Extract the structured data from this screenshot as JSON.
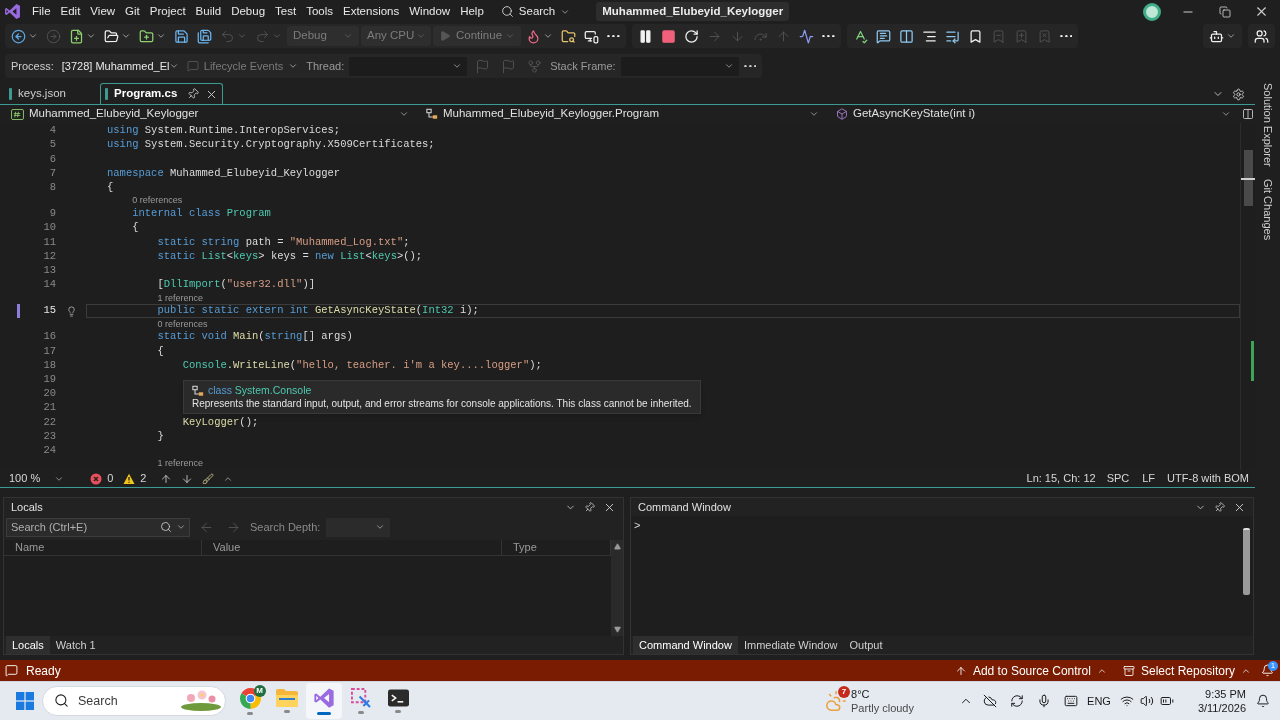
{
  "title_bar": {
    "menus": [
      "File",
      "Edit",
      "View",
      "Git",
      "Project",
      "Build",
      "Debug",
      "Test",
      "Tools",
      "Extensions",
      "Window",
      "Help"
    ],
    "search": "Search",
    "solution": "Muhammed_Elubeyid_Keylogger"
  },
  "toolbar": {
    "groups": [
      {
        "buttons": [
          {
            "kind": "navigate-back",
            "disabled": false
          },
          {
            "kind": "navigate-forward",
            "disabled": true
          },
          {
            "kind": "new-item",
            "disabled": false
          },
          {
            "kind": "open-file",
            "disabled": false
          },
          {
            "kind": "add-project",
            "disabled": false
          },
          {
            "kind": "save",
            "disabled": false
          },
          {
            "kind": "save-all",
            "disabled": false
          },
          {
            "kind": "undo",
            "disabled": true
          },
          {
            "kind": "redo",
            "disabled": true
          },
          {
            "kind": "configuration",
            "label": "Debug",
            "disabled": true
          },
          {
            "kind": "platform",
            "label": "Any CPU",
            "disabled": true
          },
          {
            "kind": "continue",
            "label": "Continue",
            "disabled": true
          },
          {
            "kind": "hot-reload",
            "disabled": false
          },
          {
            "kind": "find-in-files",
            "disabled": false
          },
          {
            "kind": "browser-link",
            "disabled": false
          },
          {
            "kind": "more",
            "disabled": false
          }
        ]
      },
      {
        "buttons": [
          {
            "kind": "pause",
            "disabled": false
          },
          {
            "kind": "stop",
            "disabled": false
          },
          {
            "kind": "restart",
            "disabled": false
          },
          {
            "kind": "show-next",
            "disabled": true
          },
          {
            "kind": "step-into",
            "disabled": true
          },
          {
            "kind": "step-over",
            "disabled": true
          },
          {
            "kind": "step-out",
            "disabled": true
          },
          {
            "kind": "diagnostics",
            "disabled": false
          },
          {
            "kind": "more",
            "disabled": false
          }
        ]
      },
      {
        "buttons": [
          {
            "kind": "spell-check",
            "disabled": false
          },
          {
            "kind": "quick-info",
            "disabled": false
          },
          {
            "kind": "parameter-info",
            "disabled": false
          },
          {
            "kind": "outdent",
            "disabled": false
          },
          {
            "kind": "indent",
            "disabled": false
          },
          {
            "kind": "bookmark",
            "disabled": false
          },
          {
            "kind": "previous-bookmark",
            "disabled": true
          },
          {
            "kind": "next-bookmark",
            "disabled": true
          },
          {
            "kind": "clear-bookmarks",
            "disabled": true
          },
          {
            "kind": "more",
            "disabled": false
          }
        ]
      },
      {
        "buttons": [
          {
            "kind": "assistant",
            "disabled": false
          }
        ]
      },
      {
        "buttons": [
          {
            "kind": "feedback",
            "disabled": false
          }
        ]
      }
    ]
  },
  "debug_location": {
    "process_label": "Process:",
    "process": "[3728] Muhammed_El",
    "lifecycle": {
      "label": "Lifecycle Events",
      "disabled": true
    },
    "thread_label": "Thread:",
    "buttons": [
      {
        "kind": "flag",
        "disabled": true
      },
      {
        "kind": "flag-all",
        "disabled": true
      },
      {
        "kind": "threads",
        "disabled": true
      }
    ],
    "stack_frame_label": "Stack Frame:"
  },
  "document_tabs": [
    {
      "label": "keys.json",
      "selected": false
    },
    {
      "label": "Program.cs",
      "selected": true
    }
  ],
  "navigation_bar": {
    "project": "Muhammed_Elubeyid_Keylogger",
    "type": "Muhammed_Elubeyid_Keylogger.Program",
    "member": "GetAsyncKeyState(int i)"
  },
  "editor": {
    "lines": [
      {
        "kind": "code",
        "number": "4",
        "current": false,
        "tokens": [
          {
            "kind": "keyword",
            "text": "using"
          },
          {
            "kind": "plain",
            "text": " System.Runtime.InteropServices;"
          }
        ]
      },
      {
        "kind": "code",
        "number": "5",
        "current": false,
        "tokens": [
          {
            "kind": "keyword",
            "text": "using"
          },
          {
            "kind": "plain",
            "text": " System.Security.Cryptography.X509Certificates;"
          }
        ]
      },
      {
        "kind": "code",
        "number": "6",
        "current": false
      },
      {
        "kind": "code",
        "number": "7",
        "current": false,
        "tokens": [
          {
            "kind": "keyword",
            "text": "namespace"
          },
          {
            "kind": "plain",
            "text": " Muhammed_Elubeyid_Keylogger"
          }
        ]
      },
      {
        "kind": "code",
        "number": "8",
        "current": false,
        "tokens": [
          {
            "kind": "plain",
            "text": "{"
          }
        ]
      },
      {
        "kind": "codelens",
        "text": "0 references"
      },
      {
        "kind": "code",
        "number": "9",
        "current": false,
        "tokens": [
          {
            "kind": "keyword",
            "text": "    internal class"
          },
          {
            "kind": "type",
            "text": " Program"
          }
        ]
      },
      {
        "kind": "code",
        "number": "10",
        "current": false,
        "tokens": [
          {
            "kind": "plain",
            "text": "    {"
          }
        ]
      },
      {
        "kind": "code",
        "number": "11",
        "current": false,
        "tokens": [
          {
            "kind": "keyword",
            "text": "        static string"
          },
          {
            "kind": "plain",
            "text": " path = "
          },
          {
            "kind": "string",
            "text": "\"Muhammed_Log.txt\""
          },
          {
            "kind": "plain",
            "text": ";"
          }
        ]
      },
      {
        "kind": "code",
        "number": "12",
        "current": false,
        "tokens": [
          {
            "kind": "keyword",
            "text": "        static"
          },
          {
            "kind": "type",
            "text": " List"
          },
          {
            "kind": "plain",
            "text": "<"
          },
          {
            "kind": "type",
            "text": "keys"
          },
          {
            "kind": "plain",
            "text": "> keys = "
          },
          {
            "kind": "keyword",
            "text": "new"
          },
          {
            "kind": "type",
            "text": " List"
          },
          {
            "kind": "plain",
            "text": "<"
          },
          {
            "kind": "type",
            "text": "keys"
          },
          {
            "kind": "plain",
            "text": ">();"
          }
        ]
      },
      {
        "kind": "code",
        "number": "13",
        "current": false
      },
      {
        "kind": "code",
        "number": "14",
        "current": false,
        "tokens": [
          {
            "kind": "plain",
            "text": "        ["
          },
          {
            "kind": "type",
            "text": "DllImport"
          },
          {
            "kind": "plain",
            "text": "("
          },
          {
            "kind": "string",
            "text": "\"user32.dll\""
          },
          {
            "kind": "plain",
            "text": ")]"
          }
        ]
      },
      {
        "kind": "codelens",
        "text": "1 reference"
      },
      {
        "kind": "code",
        "number": "15",
        "current": true,
        "tokens": [
          {
            "kind": "keyword",
            "text": "        public static extern int"
          },
          {
            "kind": "method",
            "text": " GetAsyncKeyState"
          },
          {
            "kind": "plain",
            "text": "("
          },
          {
            "kind": "type",
            "text": "Int32"
          },
          {
            "kind": "plain",
            "text": " i);"
          }
        ]
      },
      {
        "kind": "codelens",
        "text": "0 references"
      },
      {
        "kind": "code",
        "number": "16",
        "current": false,
        "tokens": [
          {
            "kind": "keyword",
            "text": "        static void"
          },
          {
            "kind": "method",
            "text": " Main"
          },
          {
            "kind": "plain",
            "text": "("
          },
          {
            "kind": "keyword",
            "text": "string"
          },
          {
            "kind": "plain",
            "text": "[] args)"
          }
        ]
      },
      {
        "kind": "code",
        "number": "17",
        "current": false,
        "tokens": [
          {
            "kind": "plain",
            "text": "        {"
          }
        ]
      },
      {
        "kind": "code",
        "number": "18",
        "current": false,
        "tokens": [
          {
            "kind": "type",
            "text": "            Console"
          },
          {
            "kind": "plain",
            "text": "."
          },
          {
            "kind": "method",
            "text": "WriteLine"
          },
          {
            "kind": "plain",
            "text": "("
          },
          {
            "kind": "string",
            "text": "\"hello, teacher. i'm a key....logger\""
          },
          {
            "kind": "plain",
            "text": ");"
          }
        ]
      },
      {
        "kind": "code",
        "number": "19",
        "current": false
      },
      {
        "kind": "code",
        "number": "20",
        "current": false
      },
      {
        "kind": "code",
        "number": "21",
        "current": false
      },
      {
        "kind": "code",
        "number": "22",
        "current": false,
        "tokens": [
          {
            "kind": "method",
            "text": "            KeyLogger"
          },
          {
            "kind": "plain",
            "text": "();"
          }
        ]
      },
      {
        "kind": "code",
        "number": "23",
        "current": false,
        "tokens": [
          {
            "kind": "plain",
            "text": "        }"
          }
        ]
      },
      {
        "kind": "code",
        "number": "24",
        "current": false
      },
      {
        "kind": "codelens",
        "text": "1 reference"
      }
    ],
    "tooltip": {
      "symbol_kind": "class",
      "name": "System.Console",
      "description": "Represents the standard input, output, and error streams for console applications. This class cannot be inherited."
    }
  },
  "side_tabs": [
    "Solution Explorer",
    "Git Changes"
  ],
  "editor_status": {
    "zoom": "100 %",
    "errors": "0",
    "warnings": "2",
    "position": "Ln: 15, Ch: 12",
    "indent": "SPC",
    "line_ending": "LF",
    "encoding": "UTF-8 with BOM"
  },
  "locals": {
    "title": "Locals",
    "search_placeholder": "Search (Ctrl+E)",
    "search_buttons": [
      {
        "kind": "search-back",
        "disabled": true
      },
      {
        "kind": "search-forward",
        "disabled": true
      }
    ],
    "search_depth_label": "Search Depth:",
    "columns": [
      "Name",
      "Value",
      "Type"
    ],
    "tabs": [
      {
        "label": "Locals",
        "selected": true
      },
      {
        "label": "Watch 1",
        "selected": false
      }
    ]
  },
  "command_window": {
    "title": "Command Window",
    "prompt": ">",
    "tabs": [
      {
        "label": "Command Window",
        "selected": true
      },
      {
        "label": "Immediate Window",
        "selected": false
      },
      {
        "label": "Output",
        "selected": false
      }
    ]
  },
  "status_bar": {
    "state": "Ready",
    "source_control": "Add to Source Control",
    "repository": "Select Repository",
    "notifications": "1"
  },
  "taskbar": {
    "search_placeholder": "Search",
    "apps": [
      {
        "kind": "browser",
        "badge": "M",
        "active": false
      },
      {
        "kind": "folder",
        "active": false
      },
      {
        "kind": "ide",
        "active": true
      },
      {
        "kind": "snip",
        "active": false
      },
      {
        "kind": "terminal",
        "active": false
      }
    ],
    "weather": {
      "alerts": "7",
      "temperature": "8°C",
      "condition": "Partly cloudy"
    },
    "language": "ENG",
    "time": "9:35 PM",
    "date": "3/11/2026"
  }
}
